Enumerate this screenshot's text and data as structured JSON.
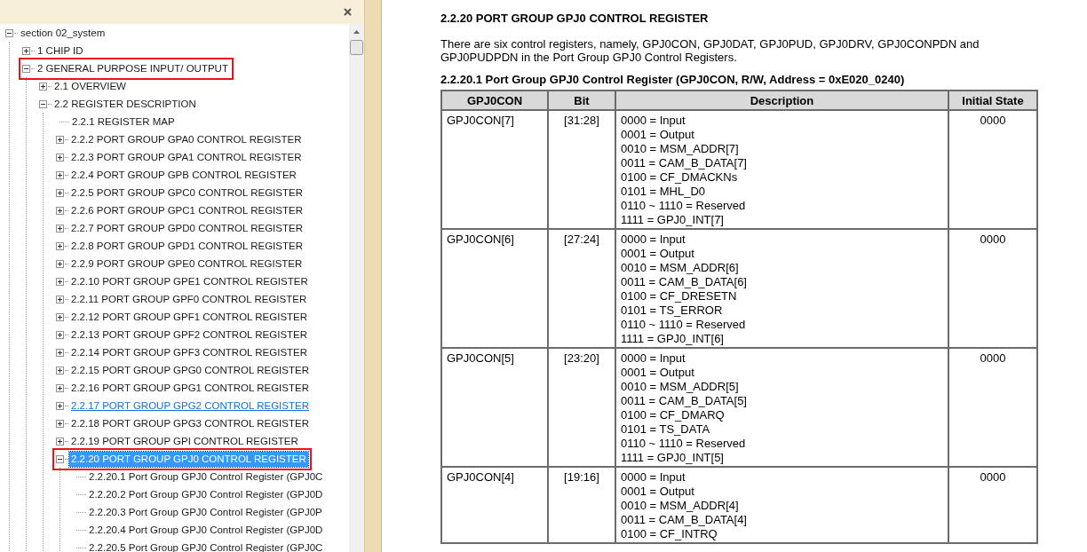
{
  "outline": {
    "tree": [
      {
        "label": "section 02_system",
        "expanded": true,
        "children": [
          {
            "label": "1 CHIP ID",
            "expanded": false
          },
          {
            "label": "2 GENERAL PURPOSE INPUT/ OUTPUT",
            "expanded": true,
            "marked": true,
            "children": [
              {
                "label": "2.1 OVERVIEW",
                "expanded": false
              },
              {
                "label": "2.2 REGISTER DESCRIPTION",
                "expanded": true,
                "children": [
                  {
                    "label": "2.2.1 REGISTER MAP"
                  },
                  {
                    "label": "2.2.2 PORT GROUP GPA0 CONTROL REGISTER",
                    "expanded": false
                  },
                  {
                    "label": "2.2.3 PORT GROUP GPA1 CONTROL REGISTER",
                    "expanded": false
                  },
                  {
                    "label": "2.2.4 PORT GROUP GPB CONTROL REGISTER",
                    "expanded": false
                  },
                  {
                    "label": "2.2.5 PORT GROUP GPC0 CONTROL REGISTER",
                    "expanded": false
                  },
                  {
                    "label": "2.2.6 PORT GROUP GPC1 CONTROL REGISTER",
                    "expanded": false
                  },
                  {
                    "label": "2.2.7 PORT GROUP GPD0 CONTROL REGISTER",
                    "expanded": false
                  },
                  {
                    "label": "2.2.8 PORT GROUP GPD1 CONTROL REGISTER",
                    "expanded": false
                  },
                  {
                    "label": "2.2.9 PORT GROUP GPE0 CONTROL REGISTER",
                    "expanded": false
                  },
                  {
                    "label": "2.2.10 PORT GROUP GPE1 CONTROL REGISTER",
                    "expanded": false
                  },
                  {
                    "label": "2.2.11 PORT GROUP GPF0 CONTROL REGISTER",
                    "expanded": false
                  },
                  {
                    "label": "2.2.12 PORT GROUP GPF1 CONTROL REGISTER",
                    "expanded": false
                  },
                  {
                    "label": "2.2.13 PORT GROUP GPF2 CONTROL REGISTER",
                    "expanded": false
                  },
                  {
                    "label": "2.2.14 PORT GROUP GPF3 CONTROL REGISTER",
                    "expanded": false
                  },
                  {
                    "label": "2.2.15 PORT GROUP GPG0 CONTROL REGISTER",
                    "expanded": false
                  },
                  {
                    "label": "2.2.16 PORT GROUP GPG1 CONTROL REGISTER",
                    "expanded": false
                  },
                  {
                    "label": "2.2.17 PORT GROUP GPG2 CONTROL REGISTER",
                    "expanded": false,
                    "hovered": true
                  },
                  {
                    "label": "2.2.18 PORT GROUP GPG3 CONTROL REGISTER",
                    "expanded": false
                  },
                  {
                    "label": "2.2.19 PORT GROUP GPI CONTROL REGISTER",
                    "expanded": false
                  },
                  {
                    "label": "2.2.20 PORT GROUP GPJ0 CONTROL REGISTER",
                    "expanded": true,
                    "selected": true,
                    "marked": true,
                    "children": [
                      {
                        "label": "2.2.20.1 Port Group GPJ0 Control Register (GPJ0C"
                      },
                      {
                        "label": "2.2.20.2 Port Group GPJ0 Control Register (GPJ0D"
                      },
                      {
                        "label": "2.2.20.3 Port Group GPJ0 Control Register (GPJ0P"
                      },
                      {
                        "label": "2.2.20.4 Port Group GPJ0 Control Register (GPJ0D"
                      },
                      {
                        "label": "2.2.20.5 Port Group GPJ0 Control Register (GPJ0C"
                      }
                    ]
                  }
                ]
              }
            ]
          }
        ]
      }
    ]
  },
  "document": {
    "heading": "2.2.20  PORT GROUP GPJ0 CONTROL REGISTER",
    "intro": "There are six control registers, namely, GPJ0CON, GPJ0DAT, GPJ0PUD, GPJ0DRV, GPJ0CONPDN and GPJ0PUDPDN in the Port Group GPJ0 Control Registers.",
    "table_title": "2.2.20.1  Port Group GPJ0 Control Register (GPJ0CON, R/W, Address = 0xE020_0240)",
    "table": {
      "columns": [
        "GPJ0CON",
        "Bit",
        "Description",
        "Initial State"
      ],
      "rows": [
        {
          "name": "GPJ0CON[7]",
          "bit": "[31:28]",
          "description": [
            "0000 = Input",
            "0001 = Output",
            "0010 = MSM_ADDR[7]",
            "0011 = CAM_B_DATA[7]",
            "0100 = CF_DMACKNs",
            "0101 = MHL_D0",
            "0110 ~ 1110 = Reserved",
            "1111 = GPJ0_INT[7]"
          ],
          "initial_state": "0000"
        },
        {
          "name": "GPJ0CON[6]",
          "bit": "[27:24]",
          "description": [
            "0000 = Input",
            "0001 = Output",
            "0010 = MSM_ADDR[6]",
            "0011 = CAM_B_DATA[6]",
            "0100 = CF_DRESETN",
            "0101 = TS_ERROR",
            "0110 ~ 1110 = Reserved",
            "1111 = GPJ0_INT[6]"
          ],
          "initial_state": "0000"
        },
        {
          "name": "GPJ0CON[5]",
          "bit": "[23:20]",
          "description": [
            "0000 = Input",
            "0001 = Output",
            "0010 = MSM_ADDR[5]",
            "0011 = CAM_B_DATA[5]",
            "0100 = CF_DMARQ",
            "0101 = TS_DATA",
            "0110 ~ 1110 = Reserved",
            "1111 = GPJ0_INT[5]"
          ],
          "initial_state": "0000"
        },
        {
          "name": "GPJ0CON[4]",
          "bit": "[19:16]",
          "description": [
            "0000 = Input",
            "0001 = Output",
            "0010 = MSM_ADDR[4]",
            "0011 = CAM_B_DATA[4]",
            "0100 = CF_INTRQ"
          ],
          "initial_state": "0000"
        }
      ]
    }
  }
}
